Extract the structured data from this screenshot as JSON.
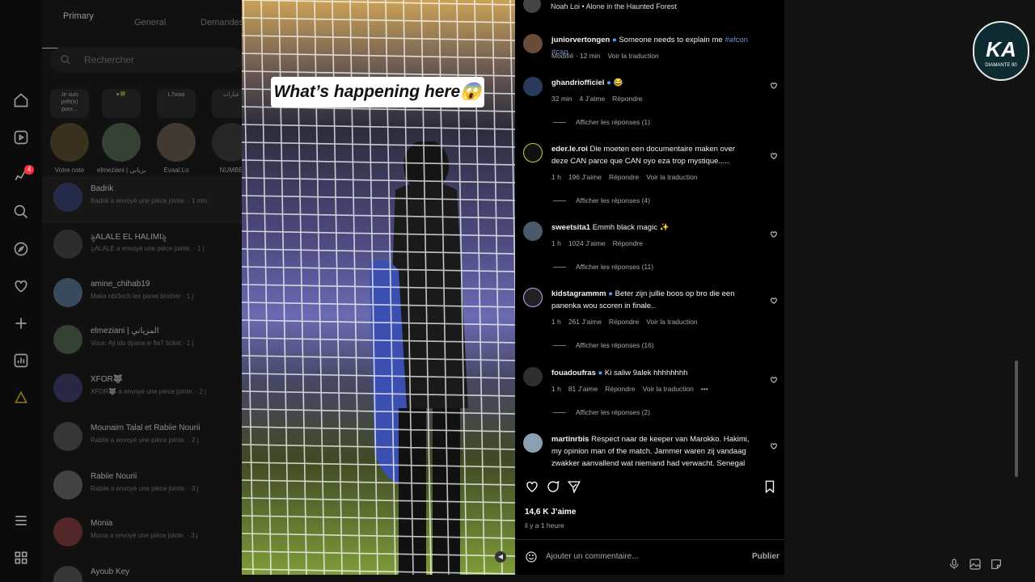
{
  "left_rail": {
    "badge": "4"
  },
  "messages": {
    "tabs": [
      "Primary",
      "General",
      "Demandes"
    ],
    "search_placeholder": "Rechercher",
    "notes": [
      {
        "bubble": "Je suis prêt(e) pour...",
        "name": "Votre note"
      },
      {
        "bubble": "♥🍀",
        "name": "elmeziani | المزياني"
      },
      {
        "bubble": "L7waa",
        "name": "Evaal.Lo"
      },
      {
        "bubble": "عبارات",
        "name": "NUMBE"
      }
    ],
    "conversations": [
      {
        "name": "Badrik",
        "sub": "Badrik a envoyé une pièce jointe. · 1 min"
      },
      {
        "name": "ৡALALE EL HALIMIৡ",
        "sub": "ৡALALE a envoyé une pièce jointe. · 1 j"
      },
      {
        "name": "amine_chihab19",
        "sub": "Maka nbi3och les panel brother · 1 j"
      },
      {
        "name": "elmeziani | المزياني",
        "sub": "Vous: Aji lds dyana w fte7 ticket · 1 j"
      },
      {
        "name": "XFOR🐺",
        "sub": "XFOR🐺 a envoyé une pièce jointe. · 2 j"
      },
      {
        "name": "Mounaim Talal et Rabiie Nourii",
        "sub": "Rabiie a envoyé une pièce jointe. · 2 j"
      },
      {
        "name": "Rabiie Nourii",
        "sub": "Rabiie a envoyé une pièce jointe. · 3 j"
      },
      {
        "name": "Monia",
        "sub": "Monia a envoyé une pièce jointe. · 3 j"
      },
      {
        "name": "Ayoub Key",
        "sub": ""
      }
    ]
  },
  "reel": {
    "caption": "What’s happening here😱"
  },
  "post": {
    "top_line": "Noah Loi • Alone in the Haunted Forest",
    "comments": [
      {
        "user": "juniorvertongen",
        "text": "Someone needs to explain me ",
        "tags": "#afcon #can",
        "meta": [
          "Modifié · 12 min",
          "Voir la traduction"
        ],
        "replies": ""
      },
      {
        "user": "ghandriofficiel",
        "text": "😂",
        "tags": "",
        "meta": [
          "32 min",
          "4 J’aime",
          "Répondre"
        ],
        "replies": "Afficher les réponses (1)"
      },
      {
        "user": "eder.le.roi",
        "text": "Die moeten een documentaire maken over deze CAN parce que CAN oyo eza trop mystique.....",
        "tags": "",
        "meta": [
          "1 h",
          "196 J’aime",
          "Répondre",
          "Voir la traduction"
        ],
        "replies": "Afficher les réponses (4)"
      },
      {
        "user": "sweetsita1",
        "text": "Emmh black magic ✨",
        "tags": "",
        "meta": [
          "1 h",
          "1024 J’aime",
          "Répondre"
        ],
        "replies": "Afficher les réponses (11)"
      },
      {
        "user": "kidstagrammm",
        "text": "Beter zijn jullie boos op bro die een panenka wou scoren in finale..",
        "tags": "",
        "meta": [
          "1 h",
          "261 J’aime",
          "Répondre",
          "Voir la traduction"
        ],
        "replies": "Afficher les réponses (16)"
      },
      {
        "user": "fouadoufras",
        "text": "Ki saliw 9alek hhhhhhhh",
        "tags": "",
        "meta": [
          "1 h",
          "81 J’aime",
          "Répondre",
          "Voir la traduction",
          "•••"
        ],
        "replies": "Afficher les réponses (2)"
      },
      {
        "user": "martinrbis",
        "text": "Respect naar de keeper van Marokko. Hakimi, my opinion man of the match. Jammer waren zij vandaag zwakker aanvallend wat niemand had verwacht. Senegal was sterker",
        "tags": "",
        "meta": [],
        "replies": ""
      }
    ],
    "likes": "14,6 K J’aime",
    "ago": "il y a 1 heure",
    "add_comment_placeholder": "Ajouter un commentaire...",
    "publish": "Publier"
  },
  "logo": {
    "text": "KA",
    "sub": "DIAMANTE 90"
  }
}
